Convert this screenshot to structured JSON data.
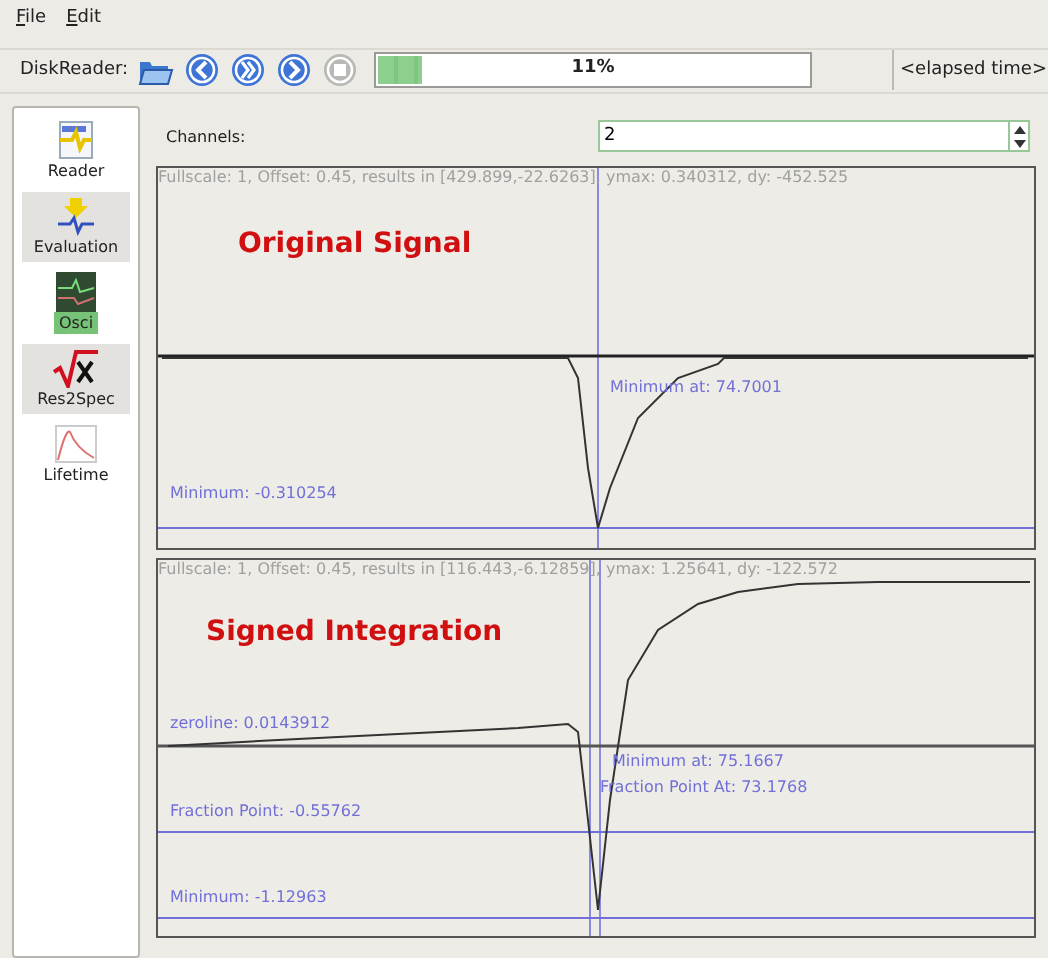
{
  "menu": [
    {
      "label": "File"
    },
    {
      "label": "Edit"
    }
  ],
  "toolbar": {
    "label": "DiskReader:",
    "progress": {
      "level": 0.11,
      "text": "11%"
    },
    "elapsed": "<elapsed time>"
  },
  "sidebar": {
    "items": [
      {
        "label": "Reader",
        "kind": "reader",
        "selected": false,
        "highlighted": false
      },
      {
        "label": "Evaluation",
        "kind": "evaluation",
        "selected": false,
        "highlighted": true
      },
      {
        "label": "Osci",
        "kind": "osci",
        "selected": true,
        "highlighted": false
      },
      {
        "label": "Res2Spec",
        "kind": "res2spec",
        "selected": false,
        "highlighted": true
      },
      {
        "label": "Lifetime",
        "kind": "lifetime",
        "selected": false,
        "highlighted": false
      }
    ]
  },
  "channels": {
    "label": "Channels:",
    "value": "2"
  },
  "plots": [
    {
      "kind": "original",
      "header": "Fullscale: 1, Offset: 0.45, results in [429.899,-22.6263], ymax: 0.340312, dy: -452.525",
      "title": "Original Signal",
      "labels": [
        "Minimum at: 74.7001",
        "Minimum: -0.310254"
      ]
    },
    {
      "kind": "integration",
      "header": "Fullscale: 1, Offset: 0.45, results in [116.443,-6.12859], ymax: 1.25641, dy: -122.572",
      "title": "Signed Integration",
      "labels": [
        "zeroline: 0.0143912",
        "Minimum at: 75.1667",
        "Fraction Point At: 73.1768",
        "Fraction Point: -0.55762",
        "Minimum: -1.12963"
      ]
    }
  ]
}
